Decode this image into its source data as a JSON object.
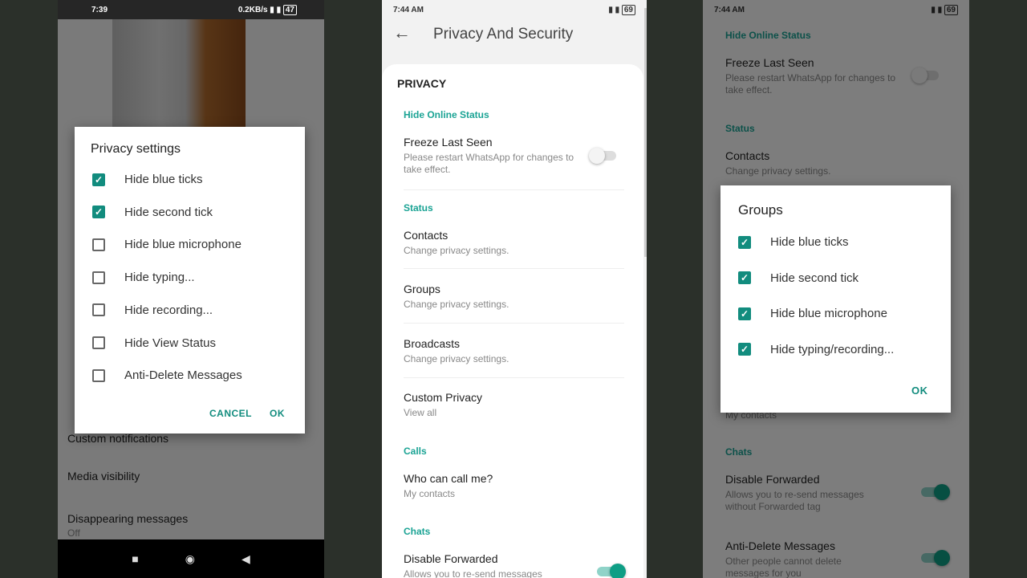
{
  "left": {
    "status": {
      "time": "7:39",
      "speed": "0.2KB/s",
      "battery": "47"
    },
    "background_items": [
      {
        "title": "Custom notifications"
      },
      {
        "title": "Media visibility"
      },
      {
        "title": "Disappearing messages",
        "subtitle": "Off"
      }
    ],
    "dialog": {
      "title": "Privacy settings",
      "options": [
        {
          "label": "Hide blue ticks",
          "checked": true
        },
        {
          "label": "Hide second tick",
          "checked": true
        },
        {
          "label": "Hide blue microphone",
          "checked": false
        },
        {
          "label": "Hide typing...",
          "checked": false
        },
        {
          "label": "Hide recording...",
          "checked": false
        },
        {
          "label": "Hide View Status",
          "checked": false
        },
        {
          "label": "Anti-Delete Messages",
          "checked": false
        }
      ],
      "cancel": "CANCEL",
      "ok": "OK"
    }
  },
  "middle": {
    "status": {
      "time": "7:44 AM",
      "battery": "69"
    },
    "header": {
      "title": "Privacy And Security"
    },
    "privacy_heading": "PRIVACY",
    "sections": {
      "hide_online": "Hide Online Status",
      "status": "Status",
      "calls": "Calls",
      "chats": "Chats"
    },
    "items": {
      "freeze": {
        "title": "Freeze Last Seen",
        "subtitle": "Please restart WhatsApp for changes to take effect.",
        "on": false
      },
      "contacts": {
        "title": "Contacts",
        "subtitle": "Change privacy settings."
      },
      "groups": {
        "title": "Groups",
        "subtitle": "Change privacy settings."
      },
      "broadcasts": {
        "title": "Broadcasts",
        "subtitle": "Change privacy settings."
      },
      "custom": {
        "title": "Custom Privacy",
        "subtitle": "View all"
      },
      "call": {
        "title": "Who can call me?",
        "subtitle": "My contacts"
      },
      "forward": {
        "title": "Disable Forwarded",
        "subtitle": "Allows you to re-send messages",
        "on": true
      }
    }
  },
  "right": {
    "status": {
      "time": "7:44 AM",
      "battery": "69"
    },
    "sections": {
      "hide_online": "Hide Online Status",
      "status": "Status",
      "chats": "Chats"
    },
    "items": {
      "freeze": {
        "title": "Freeze Last Seen",
        "subtitle": "Please restart WhatsApp for changes to take effect.",
        "on": false
      },
      "contacts": {
        "title": "Contacts",
        "subtitle": "Change privacy settings."
      },
      "call_sub": "My contacts",
      "forward": {
        "title": "Disable Forwarded",
        "subtitle": "Allows you to re-send messages without Forwarded tag",
        "on": true
      },
      "antidelete": {
        "title": "Anti-Delete Messages",
        "subtitle": "Other people cannot delete messages for you",
        "on": true
      }
    },
    "dialog": {
      "title": "Groups",
      "options": [
        {
          "label": "Hide blue ticks",
          "checked": true
        },
        {
          "label": "Hide second tick",
          "checked": true
        },
        {
          "label": "Hide blue microphone",
          "checked": true
        },
        {
          "label": "Hide typing/recording...",
          "checked": true
        }
      ],
      "ok": "OK"
    }
  },
  "colors": {
    "accent": "#128c7e",
    "section": "#1aa394"
  }
}
